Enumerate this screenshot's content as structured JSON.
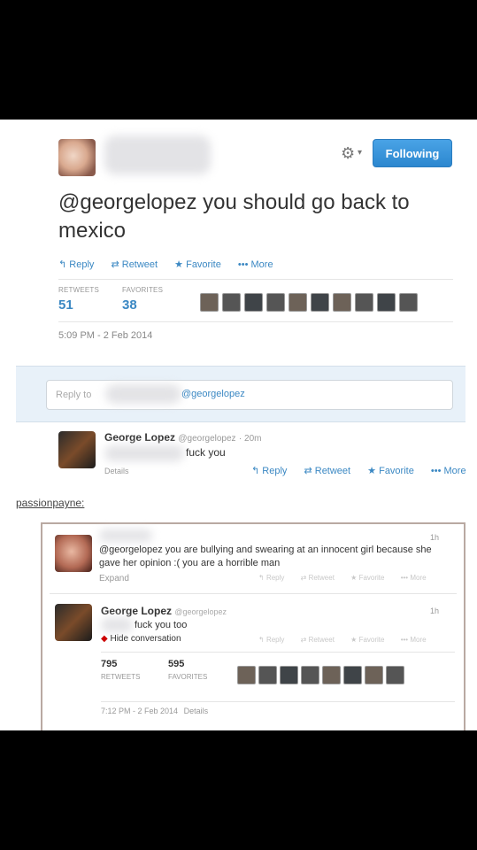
{
  "follow_button": "Following",
  "main_tweet": {
    "text": "@georgelopez you should go back to mexico",
    "actions": [
      "Reply",
      "Retweet",
      "Favorite",
      "More"
    ],
    "retweets_label": "RETWEETS",
    "retweets": "51",
    "favorites_label": "FAVORITES",
    "favorites": "38",
    "timestamp": "5:09 PM - 2 Feb 2014"
  },
  "reply_box": {
    "placeholder": "Reply to",
    "handle": "@georgelopez"
  },
  "reply1": {
    "name": "George Lopez",
    "handle": "@georgelopez",
    "age": "· 20m",
    "text": "fuck you",
    "details": "Details",
    "actions": [
      "Reply",
      "Retweet",
      "Favorite",
      "More"
    ]
  },
  "reblog_user": "passionpayne:",
  "second_tweet": {
    "time": "1h",
    "text": "@georgelopez you are bullying and swearing at an innocent girl because she gave her opinion :( you are a horrible man",
    "expand": "Expand",
    "actions": [
      "Reply",
      "Retweet",
      "Favorite",
      "More"
    ]
  },
  "reply2": {
    "name": "George Lopez",
    "handle": "@georgelopez",
    "time": "1h",
    "text": "fuck you too",
    "hide": "Hide conversation",
    "actions": [
      "Reply",
      "Retweet",
      "Favorite",
      "More"
    ],
    "retweets": "795",
    "retweets_label": "RETWEETS",
    "favorites": "595",
    "favorites_label": "FAVORITES",
    "timestamp": "7:12 PM - 2 Feb 2014",
    "details": "Details"
  },
  "colors": {
    "link": "#3b88c3",
    "follow": "#2c87cf",
    "hide_dot": "#cc0000"
  }
}
